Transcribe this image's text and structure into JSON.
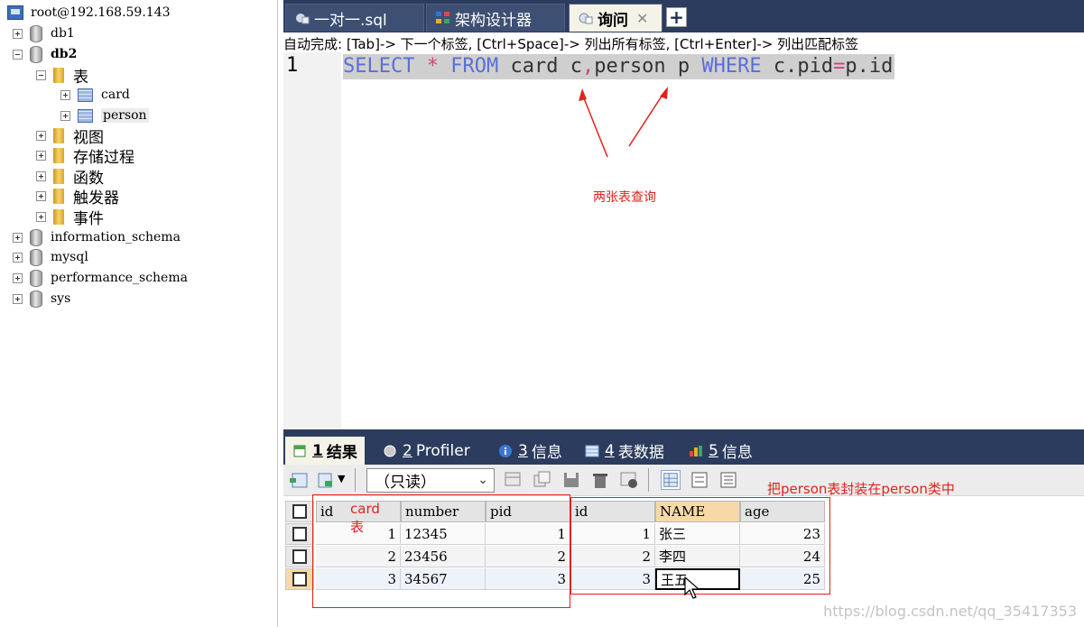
{
  "tree": {
    "root": "root@192.168.59.143",
    "db1": "db1",
    "db2": "db2",
    "tables_folder": "表",
    "table_card": "card",
    "table_person": "person",
    "views": "视图",
    "procedures": "存储过程",
    "functions": "函数",
    "triggers": "触发器",
    "events": "事件",
    "info_schema": "information_schema",
    "mysql": "mysql",
    "perf_schema": "performance_schema",
    "sys": "sys"
  },
  "tabs": {
    "t1": "一对一.sql",
    "t2": "架构设计器",
    "t3": "询问",
    "close": "✕",
    "new": "+"
  },
  "editor": {
    "hint": "自动完成: [Tab]-> 下一个标签, [Ctrl+Space]-> 列出所有标签, [Ctrl+Enter]-> 列出匹配标签",
    "line_number": "1",
    "sql": {
      "k1": "SELECT",
      "star": "*",
      "k2": "FROM",
      "p1": "card c",
      "comma": ",",
      "p2": "person p",
      "k3": "WHERE",
      "p3": "c.pid",
      "eq": "=",
      "p4": "p.id"
    },
    "annotation": "两张表查询"
  },
  "result_tabs": {
    "r1_num": "1",
    "r1": "结果",
    "r2_num": "2",
    "r2": "Profiler",
    "r3_num": "3",
    "r3": "信息",
    "r4_num": "4",
    "r4": "表数据",
    "r5_num": "5",
    "r5": "信息"
  },
  "toolbar": {
    "mode": "（只读）",
    "annotation": "把person表封装在person类中"
  },
  "grid": {
    "columns": [
      "id",
      "number",
      "pid",
      "id",
      "NAME",
      "age"
    ],
    "card_label": "card表",
    "rows": [
      [
        "1",
        "12345",
        "1",
        "1",
        "张三",
        "23"
      ],
      [
        "2",
        "23456",
        "2",
        "2",
        "李四",
        "24"
      ],
      [
        "3",
        "34567",
        "3",
        "3",
        "王五",
        "25"
      ]
    ]
  },
  "watermark": "https://blog.csdn.net/qq_35417353",
  "colors": {
    "sql_keyword": "#5b6fd6",
    "sql_operator": "#d0427f",
    "annotation_red": "#e0231c",
    "panel_navy": "#2c3c5e"
  }
}
